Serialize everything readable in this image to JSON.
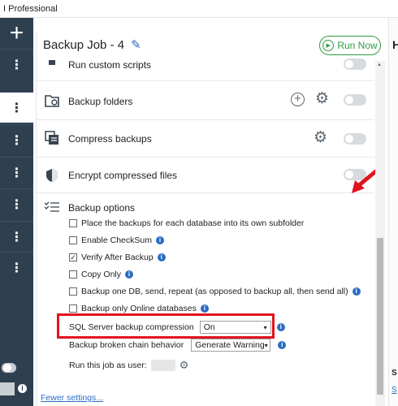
{
  "window": {
    "title": "I Professional"
  },
  "rail": {
    "add_label": "+",
    "item_glyph": "⋮"
  },
  "header": {
    "title": "Backup Job - 4",
    "run_now": "Run Now"
  },
  "rows": {
    "custom_scripts": "Run custom scripts",
    "backup_folders": "Backup folders",
    "compress_backups": "Compress backups",
    "encrypt_files": "Encrypt compressed files",
    "backup_options": "Backup options"
  },
  "options": {
    "subfolder": "Place the backups for each database into its own subfolder",
    "checksum": "Enable CheckSum",
    "verify": "Verify After Backup",
    "copy_only": "Copy Only",
    "one_db": "Backup one DB, send, repeat (as opposed to backup all, then send all)",
    "online_only": "Backup only Online databases",
    "checked_mark": "✓"
  },
  "settings": {
    "compression_label": "SQL Server backup compression",
    "compression_value": "On",
    "chain_label": "Backup broken chain behavior",
    "chain_value": "Generate Warning",
    "run_as_label": "Run this job as user:"
  },
  "footer": {
    "fewer_settings": "Fewer settings..."
  },
  "right_pane": {
    "heading": "H",
    "section": "S",
    "link": "S"
  },
  "icons": {
    "pencil": "pencil-icon",
    "play": "play-icon",
    "gear": "gear-icon",
    "plus": "add-circle-icon",
    "info": "info-icon",
    "chevron": "chevron-down-icon"
  },
  "colors": {
    "accent_blue": "#2b6cc4",
    "run_green": "#2e9b42",
    "rail_bg": "#2e3f50",
    "highlight_red": "#e0141e"
  }
}
